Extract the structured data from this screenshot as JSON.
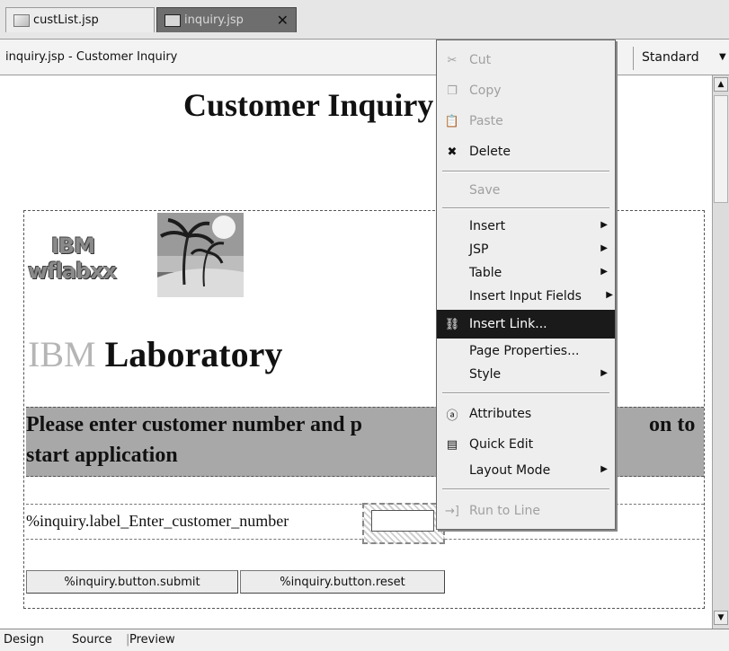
{
  "tabs": [
    {
      "label": "custList.jsp",
      "icon": "jsp-file-icon"
    },
    {
      "label": "inquiry.jsp",
      "icon": "jsp-file-icon",
      "close": "✕"
    }
  ],
  "editor": {
    "title": "inquiry.jsp - Customer Inquiry",
    "mode": "Standard"
  },
  "page": {
    "heading": "Customer Inquiry",
    "logo_text_1": "IBM",
    "logo_text_2": "wflabxx",
    "lab_heading_ibm": "IBM",
    "lab_heading_rest": "Laboratory",
    "banner_line_1": "Please enter customer number and p",
    "banner_line_1_end": "on to",
    "banner_line_2": "start application",
    "field_label": "%inquiry.label_Enter_customer_number",
    "submit_label": "%inquiry.button.submit",
    "reset_label": "%inquiry.button.reset"
  },
  "bottom_tabs": [
    "Design",
    "Source",
    "Preview"
  ],
  "context_menu": {
    "items": [
      {
        "label": "Cut",
        "icon": "scissors-icon",
        "enabled": false
      },
      {
        "label": "Copy",
        "icon": "copy-icon",
        "enabled": false
      },
      {
        "label": "Paste",
        "icon": "paste-icon",
        "enabled": false
      },
      {
        "label": "Delete",
        "icon": "delete-icon",
        "enabled": true
      },
      {
        "label": "Save",
        "enabled": false
      },
      {
        "label": "Insert",
        "submenu": true
      },
      {
        "label": "JSP",
        "submenu": true
      },
      {
        "label": "Table",
        "submenu": true
      },
      {
        "label": "Insert Input Fields",
        "submenu": true
      },
      {
        "label": "Insert Link...",
        "icon": "link-icon",
        "selected": true
      },
      {
        "label": "Page Properties..."
      },
      {
        "label": "Style",
        "submenu": true
      },
      {
        "label": "Attributes",
        "icon": "attributes-icon"
      },
      {
        "label": "Quick Edit",
        "icon": "quick-edit-icon"
      },
      {
        "label": "Layout Mode",
        "submenu": true
      },
      {
        "label": "Run to Line",
        "icon": "run-to-line-icon",
        "enabled": false
      }
    ]
  }
}
